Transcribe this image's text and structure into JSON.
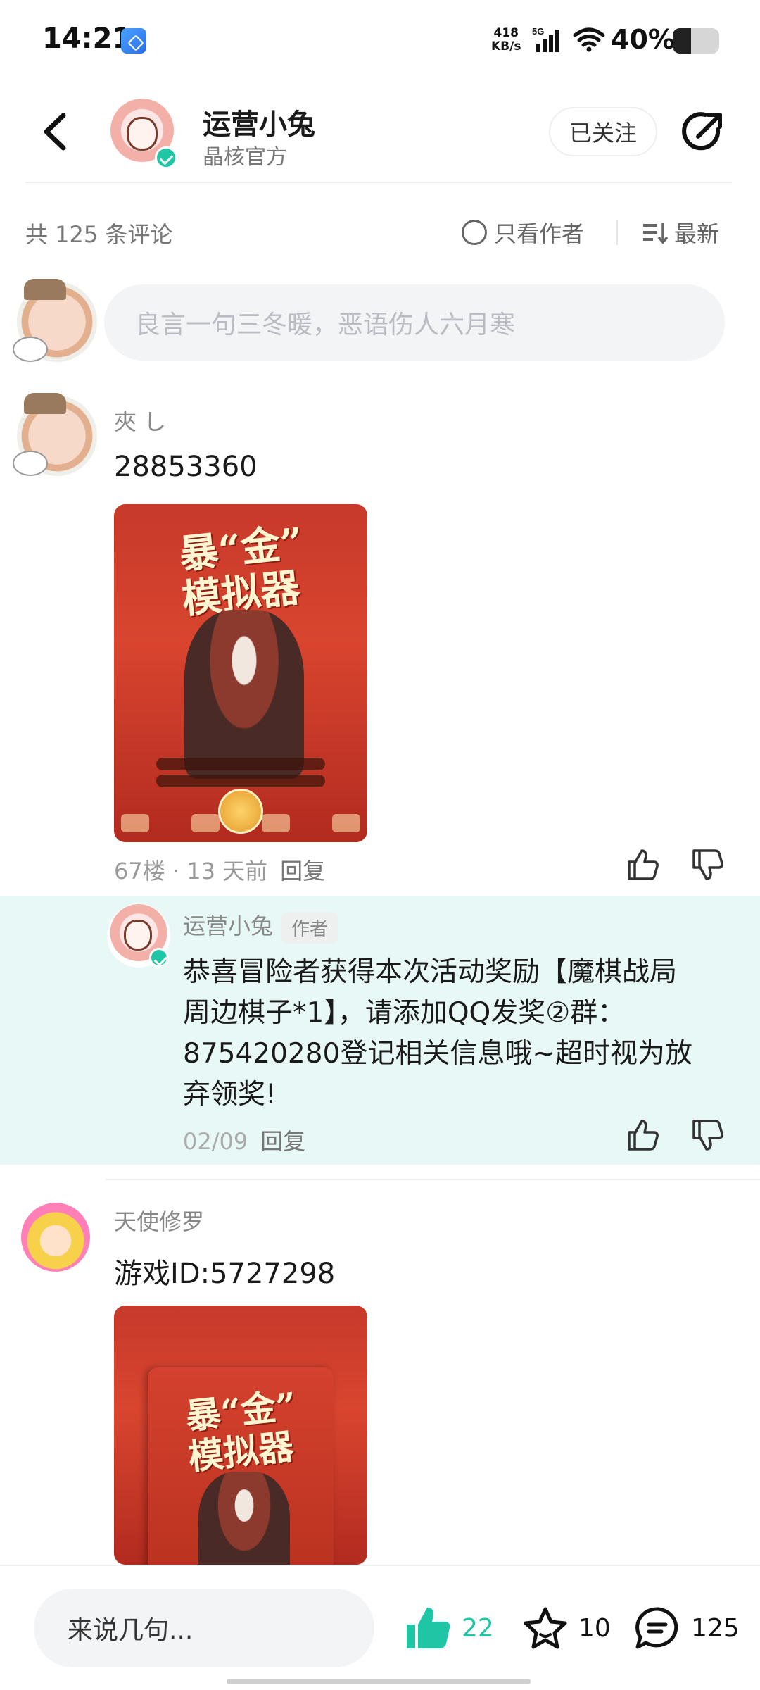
{
  "status_bar": {
    "time": "14:21",
    "net_speed_value": "418",
    "net_speed_unit": "KB/s",
    "network": "5G",
    "battery_text": "40%",
    "battery_level": 0.4
  },
  "header": {
    "name": "运营小兔",
    "subtitle": "晶核官方",
    "follow_label": "已关注"
  },
  "comments_bar": {
    "count_label": "共 125 条评论",
    "only_author_label": "只看作者",
    "sort_label": "最新"
  },
  "input": {
    "placeholder": "良言一句三冬暖，恶语伤人六月寒"
  },
  "comments": [
    {
      "username": "夾 し",
      "text": "28853360",
      "meta_floor": "67楼 · 13 天前",
      "reply_label": "回复",
      "poster": {
        "title_line1": "暴“金”",
        "title_line2": "模拟器"
      },
      "reply": {
        "username": "运营小兔",
        "author_tag": "作者",
        "text_line1": "恭喜冒险者获得本次活动奖励【魔棋战局",
        "text_line2": "周边棋子*1】，请添加QQ发奖②群：",
        "text_line3": "875420280登记相关信息哦~超时视为放",
        "text_line4": "弃领奖!",
        "date": "02/09",
        "reply_label": "回复"
      }
    },
    {
      "username": "天使修罗",
      "text": "游戏ID:5727298",
      "poster": {
        "title_line1": "暴“金”",
        "title_line2": "模拟器"
      }
    }
  ],
  "bottom_bar": {
    "input_label": "来说几句...",
    "likes": "22",
    "favorites": "10",
    "comments": "125",
    "like_color": "#1fc6a6"
  }
}
